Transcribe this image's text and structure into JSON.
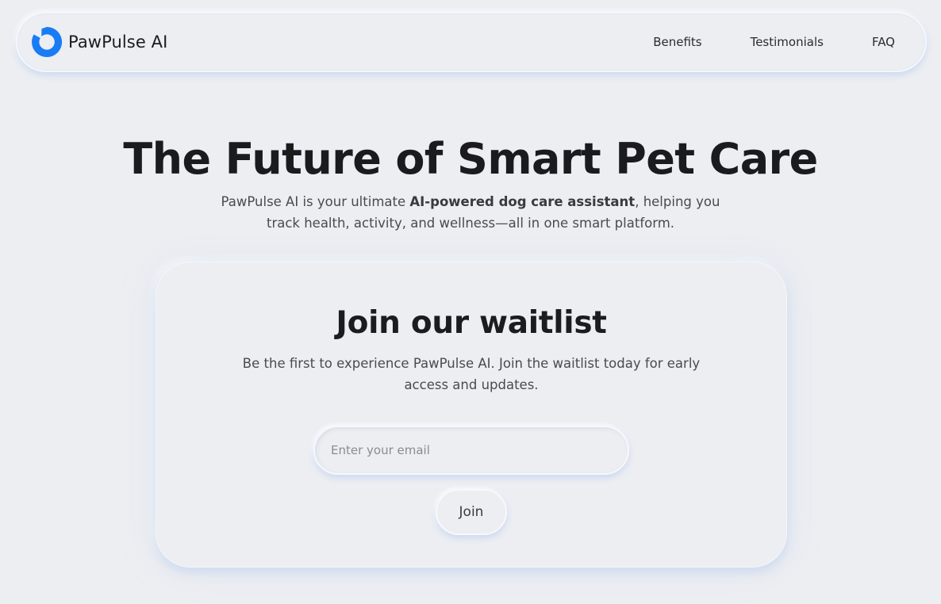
{
  "brand": {
    "name": "PawPulse AI",
    "logo_icon": "pawpulse-logo-icon",
    "accent_color": "#1a7cf5"
  },
  "nav": {
    "links": [
      {
        "label": "Benefits"
      },
      {
        "label": "Testimonials"
      },
      {
        "label": "FAQ"
      }
    ]
  },
  "hero": {
    "title": "The Future of Smart Pet Care",
    "subtitle_pre": "PawPulse AI is your ultimate ",
    "subtitle_bold": "AI-powered dog care assistant",
    "subtitle_post": ", helping you track health, activity, and wellness—all in one smart platform."
  },
  "waitlist": {
    "title": "Join our waitlist",
    "subtitle": "Be the first to experience PawPulse AI. Join the waitlist today for early access and updates.",
    "email_placeholder": "Enter your email",
    "email_value": "",
    "join_label": "Join"
  }
}
